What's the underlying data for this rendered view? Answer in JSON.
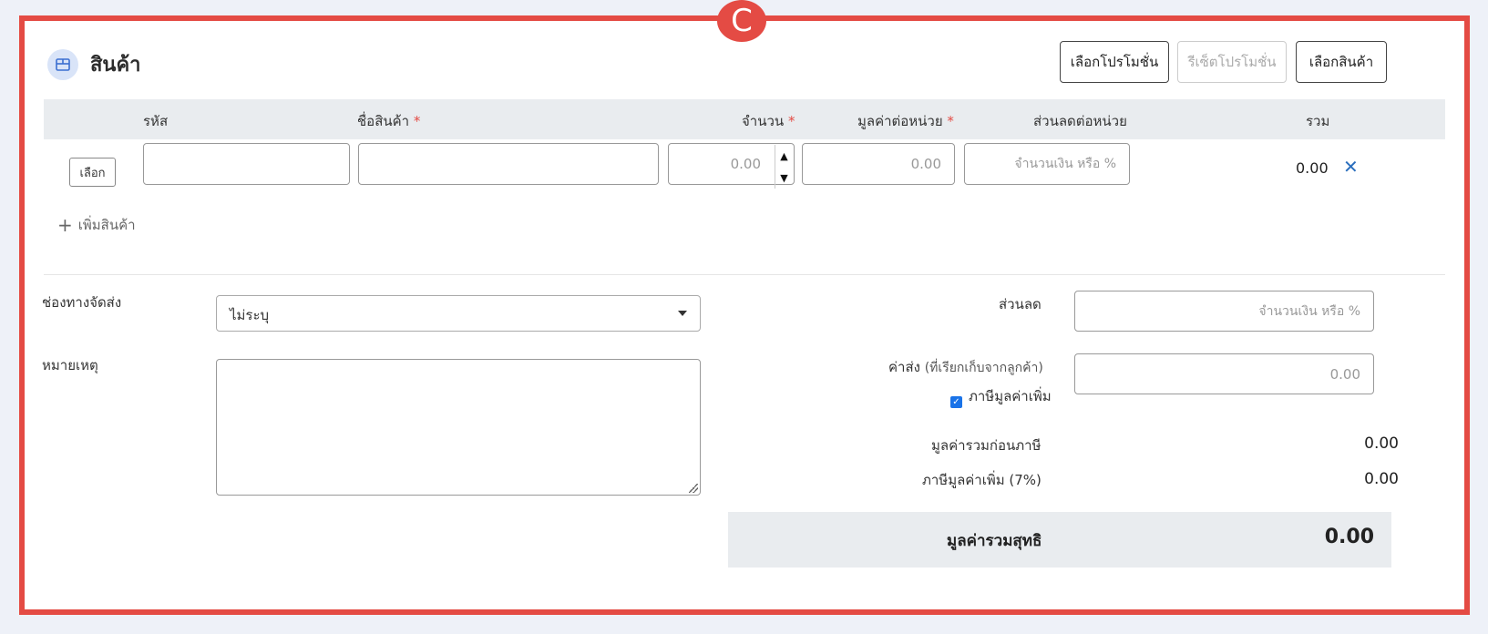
{
  "badge": "C",
  "section": {
    "title": "สินค้า",
    "icon": "box-icon"
  },
  "buttons": {
    "select_promotion": "เลือกโปรโมชั่น",
    "reset_promotion": "รีเซ็ตโปรโมชั่น",
    "select_product": "เลือกสินค้า"
  },
  "table": {
    "headers": {
      "code": "รหัส",
      "name": "ชื่อสินค้า",
      "quantity": "จำนวน",
      "unit_price": "มูลค่าต่อหน่วย",
      "unit_discount": "ส่วนลดต่อหน่วย",
      "total": "รวม"
    },
    "required_mark": "*",
    "row": {
      "select_label": "เลือก",
      "code": "",
      "name": "",
      "quantity_placeholder": "0.00",
      "unit_price_placeholder": "0.00",
      "discount_placeholder": "จำนวนเงิน หรือ %",
      "total": "0.00"
    }
  },
  "add_item": "เพิ่มสินค้า",
  "form": {
    "shipping_label": "ช่องทางจัดส่ง",
    "shipping_value": "ไม่ระบุ",
    "note_label": "หมายเหตุ",
    "note_value": ""
  },
  "summary": {
    "discount_label": "ส่วนลด",
    "discount_placeholder": "จำนวนเงิน หรือ %",
    "shipping_fee_label": "ค่าส่ง",
    "shipping_fee_sub": "(ที่เรียกเก็บจากลูกค้า)",
    "shipping_fee_placeholder": "0.00",
    "vat_checkbox_label": "ภาษีมูลค่าเพิ่ม",
    "vat_checked": true,
    "pre_tax_label": "มูลค่ารวมก่อนภาษี",
    "pre_tax_value": "0.00",
    "vat_label": "ภาษีมูลค่าเพิ่ม (7%)",
    "vat_value": "0.00",
    "net_label": "มูลค่ารวมสุทธิ",
    "net_value": "0.00"
  },
  "colors": {
    "frame": "#e44b44",
    "link": "#2a6ebd",
    "header_bg": "#e9ecef"
  }
}
